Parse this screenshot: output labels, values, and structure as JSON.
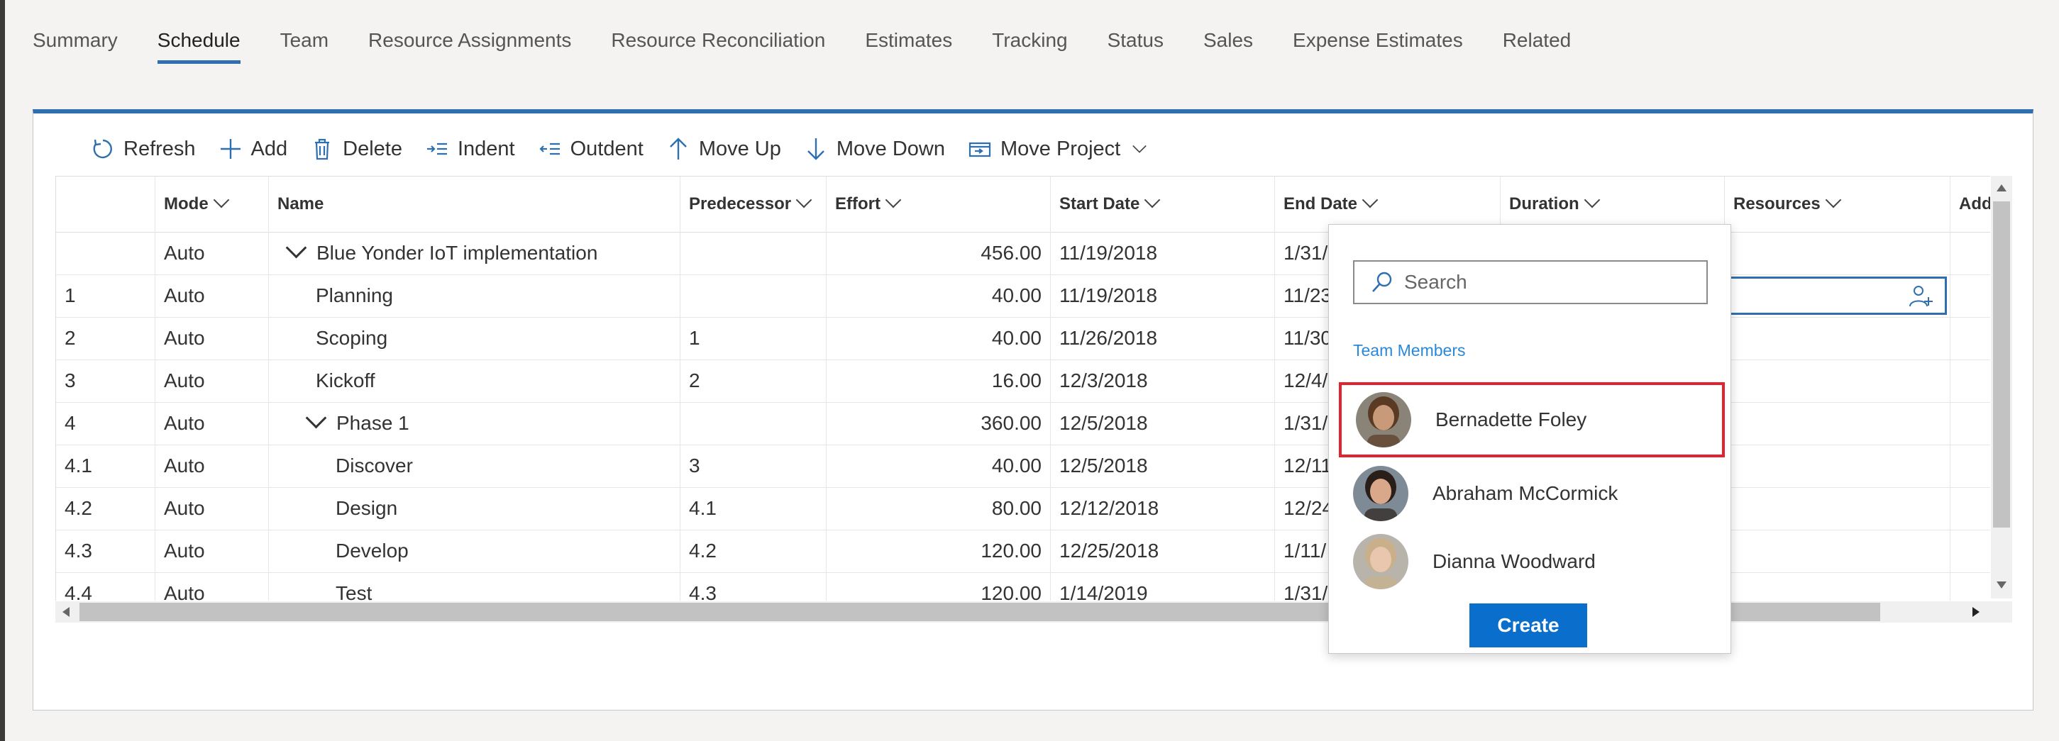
{
  "tabs": [
    "Summary",
    "Schedule",
    "Team",
    "Resource Assignments",
    "Resource Reconciliation",
    "Estimates",
    "Tracking",
    "Status",
    "Sales",
    "Expense Estimates",
    "Related"
  ],
  "active_tab": "Schedule",
  "toolbar": {
    "refresh": "Refresh",
    "add": "Add",
    "delete": "Delete",
    "indent": "Indent",
    "outdent": "Outdent",
    "move_up": "Move Up",
    "move_down": "Move Down",
    "move_project": "Move Project"
  },
  "grid": {
    "headers": {
      "mode": "Mode",
      "name": "Name",
      "predecessor": "Predecessor",
      "effort": "Effort",
      "start_date": "Start Date",
      "end_date": "End Date",
      "duration": "Duration",
      "resources": "Resources",
      "add": "Add"
    },
    "rows": [
      {
        "id": "",
        "mode": "Auto",
        "name": "Blue Yonder IoT implementation",
        "pred": "",
        "effort": "456.00",
        "start": "11/19/2018",
        "end": "1/31/",
        "level": 0,
        "expander": true
      },
      {
        "id": "1",
        "mode": "Auto",
        "name": "Planning",
        "pred": "",
        "effort": "40.00",
        "start": "11/19/2018",
        "end": "11/23",
        "level": 1,
        "expander": false
      },
      {
        "id": "2",
        "mode": "Auto",
        "name": "Scoping",
        "pred": "1",
        "effort": "40.00",
        "start": "11/26/2018",
        "end": "11/30",
        "level": 1,
        "expander": false
      },
      {
        "id": "3",
        "mode": "Auto",
        "name": "Kickoff",
        "pred": "2",
        "effort": "16.00",
        "start": "12/3/2018",
        "end": "12/4/",
        "level": 1,
        "expander": false
      },
      {
        "id": "4",
        "mode": "Auto",
        "name": "Phase 1",
        "pred": "",
        "effort": "360.00",
        "start": "12/5/2018",
        "end": "1/31/",
        "level": 1,
        "expander": true
      },
      {
        "id": "4.1",
        "mode": "Auto",
        "name": "Discover",
        "pred": "3",
        "effort": "40.00",
        "start": "12/5/2018",
        "end": "12/11",
        "level": 2,
        "expander": false
      },
      {
        "id": "4.2",
        "mode": "Auto",
        "name": "Design",
        "pred": "4.1",
        "effort": "80.00",
        "start": "12/12/2018",
        "end": "12/24",
        "level": 2,
        "expander": false
      },
      {
        "id": "4.3",
        "mode": "Auto",
        "name": "Develop",
        "pred": "4.2",
        "effort": "120.00",
        "start": "12/25/2018",
        "end": "1/11/",
        "level": 2,
        "expander": false
      },
      {
        "id": "4.4",
        "mode": "Auto",
        "name": "Test",
        "pred": "4.3",
        "effort": "120.00",
        "start": "1/14/2019",
        "end": "1/31/",
        "level": 2,
        "expander": false
      }
    ]
  },
  "resource_popup": {
    "search_placeholder": "Search",
    "section_label": "Team Members",
    "members": [
      {
        "name": "Bernadette Foley",
        "selected": true,
        "skin": "#c99a7a",
        "hair": "#5a3a22",
        "bg": "#8a8478"
      },
      {
        "name": "Abraham McCormick",
        "selected": false,
        "skin": "#d9a88a",
        "hair": "#2a1f18",
        "bg": "#7e8a96"
      },
      {
        "name": "Dianna Woodward",
        "selected": false,
        "skin": "#e8c7ae",
        "hair": "#c9b08a",
        "bg": "#b8b4ac"
      }
    ],
    "create_label": "Create"
  },
  "colors": {
    "accent": "#2f6fb0",
    "selection": "#e0232e",
    "button": "#0a6fcc",
    "link": "#2b88d8"
  }
}
